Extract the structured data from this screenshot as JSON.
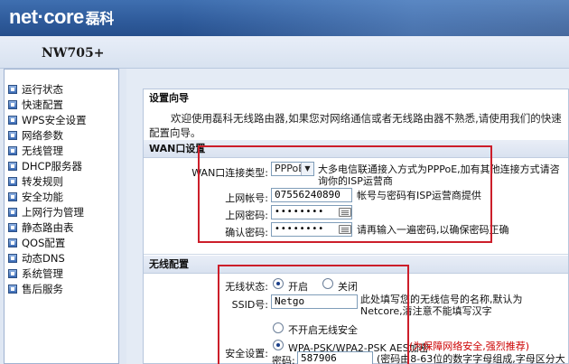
{
  "header": {
    "logo_main": "net·core",
    "logo_cn": "磊科"
  },
  "model": "NW705+",
  "sidebar": {
    "items": [
      {
        "label": "运行状态"
      },
      {
        "label": "快速配置"
      },
      {
        "label": "WPS安全设置"
      },
      {
        "label": "网络参数"
      },
      {
        "label": "无线管理"
      },
      {
        "label": "DHCP服务器"
      },
      {
        "label": "转发规则"
      },
      {
        "label": "安全功能"
      },
      {
        "label": "上网行为管理"
      },
      {
        "label": "静态路由表"
      },
      {
        "label": "QOS配置"
      },
      {
        "label": "动态DNS"
      },
      {
        "label": "系统管理"
      },
      {
        "label": "售后服务"
      }
    ]
  },
  "wizard": {
    "title": "设置向导",
    "intro": "欢迎使用磊科无线路由器,如果您对网络通信或者无线路由器不熟悉,请使用我们的快速配置向导。"
  },
  "wan": {
    "title": "WAN口设置",
    "conn_type_label": "WAN口连接类型:",
    "conn_type_value": "PPPoE",
    "conn_type_hint": "大多电信联通接入方式为PPPoE,加有其他连接方式请咨询你的ISP运营商",
    "account_label": "上网帐号:",
    "account_value": "07556240890",
    "account_hint": "帐号与密码有ISP运营商提供",
    "password_label": "上网密码:",
    "password_value": "••••••••",
    "confirm_label": "确认密码:",
    "confirm_value": "••••••••",
    "confirm_hint": "请再输入一遍密码,以确保密码正确"
  },
  "wireless": {
    "title": "无线配置",
    "status_label": "无线状态:",
    "status_on": "开启",
    "status_off": "关闭",
    "ssid_label": "SSID号:",
    "ssid_value": "Netgo",
    "ssid_hint": "此处填写您的无线信号的名称,默认为Netcore,清注意不能填写汉字",
    "security_label": "安全设置:",
    "sec_none": "不开启无线安全",
    "sec_wpa": "WPA-PSK/WPA2-PSK AES加密",
    "sec_wpa_hint": "(为保障网络安全,强烈推荐)",
    "key_label": "密码:",
    "key_value": "587906",
    "key_hint": "(密码由8-63位的数字字母组成,字母区分大小写)"
  }
}
